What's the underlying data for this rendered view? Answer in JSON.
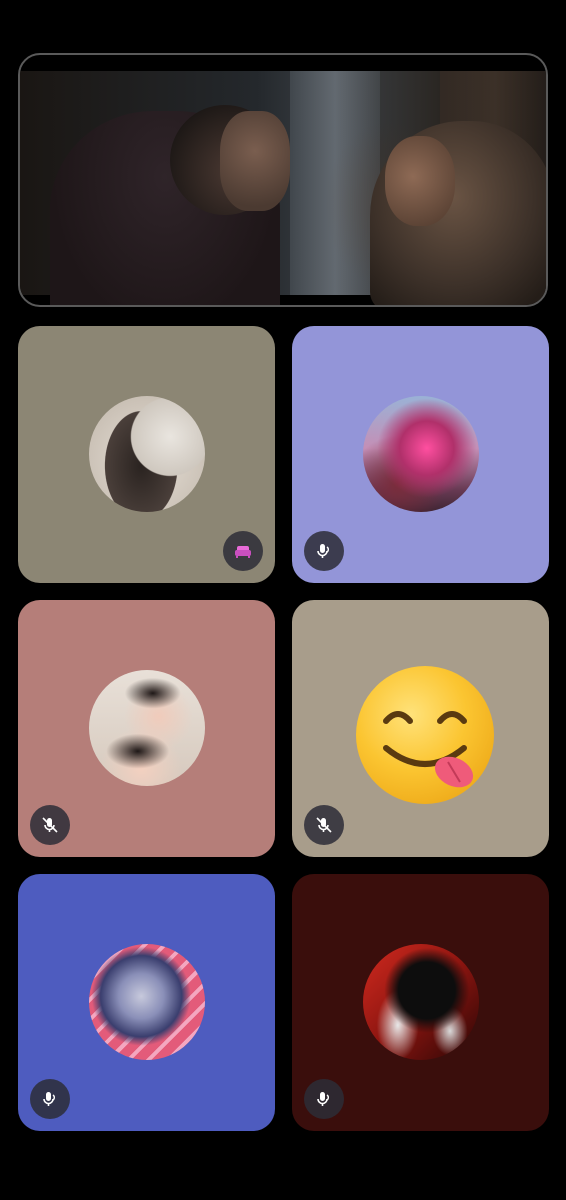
{
  "screen_share": {
    "label": "screen-share-stream"
  },
  "colors": {
    "tile_1": "#8c8674",
    "tile_2": "#9395d8",
    "tile_3": "#b57e79",
    "tile_4": "#a89d8b",
    "tile_5": "#4e5cbf",
    "tile_6": "#3a0e0c",
    "badge_bg": "#2d2d37"
  },
  "tiles": [
    {
      "name": "participant-1",
      "status_icon": "sofa-activity-icon"
    },
    {
      "name": "participant-2",
      "status_icon": "mic-speaking-icon"
    },
    {
      "name": "participant-3",
      "status_icon": "mic-muted-icon"
    },
    {
      "name": "participant-4",
      "status_icon": "mic-muted-icon"
    },
    {
      "name": "participant-5",
      "status_icon": "mic-speaking-icon"
    },
    {
      "name": "participant-6",
      "status_icon": "mic-speaking-icon"
    }
  ]
}
